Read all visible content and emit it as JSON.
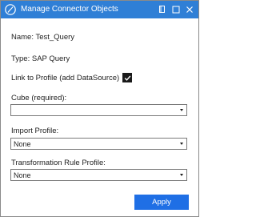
{
  "window": {
    "title": "Manage Connector Objects",
    "titlebar_color": "#2f7fd6",
    "controls": [
      "restore-icon",
      "maximize-icon",
      "close-icon"
    ]
  },
  "form": {
    "name_text": "Name: Test_Query",
    "type_text": "Type: SAP Query",
    "link_label": "Link to Profile (add DataSource)",
    "link_checked": true,
    "cube_label": "Cube (required):",
    "cube_value": "",
    "import_label": "Import Profile:",
    "import_value": "None",
    "transform_label": "Transformation Rule Profile:",
    "transform_value": "None"
  },
  "actions": {
    "apply_label": "Apply",
    "apply_color": "#1f6fe5"
  }
}
